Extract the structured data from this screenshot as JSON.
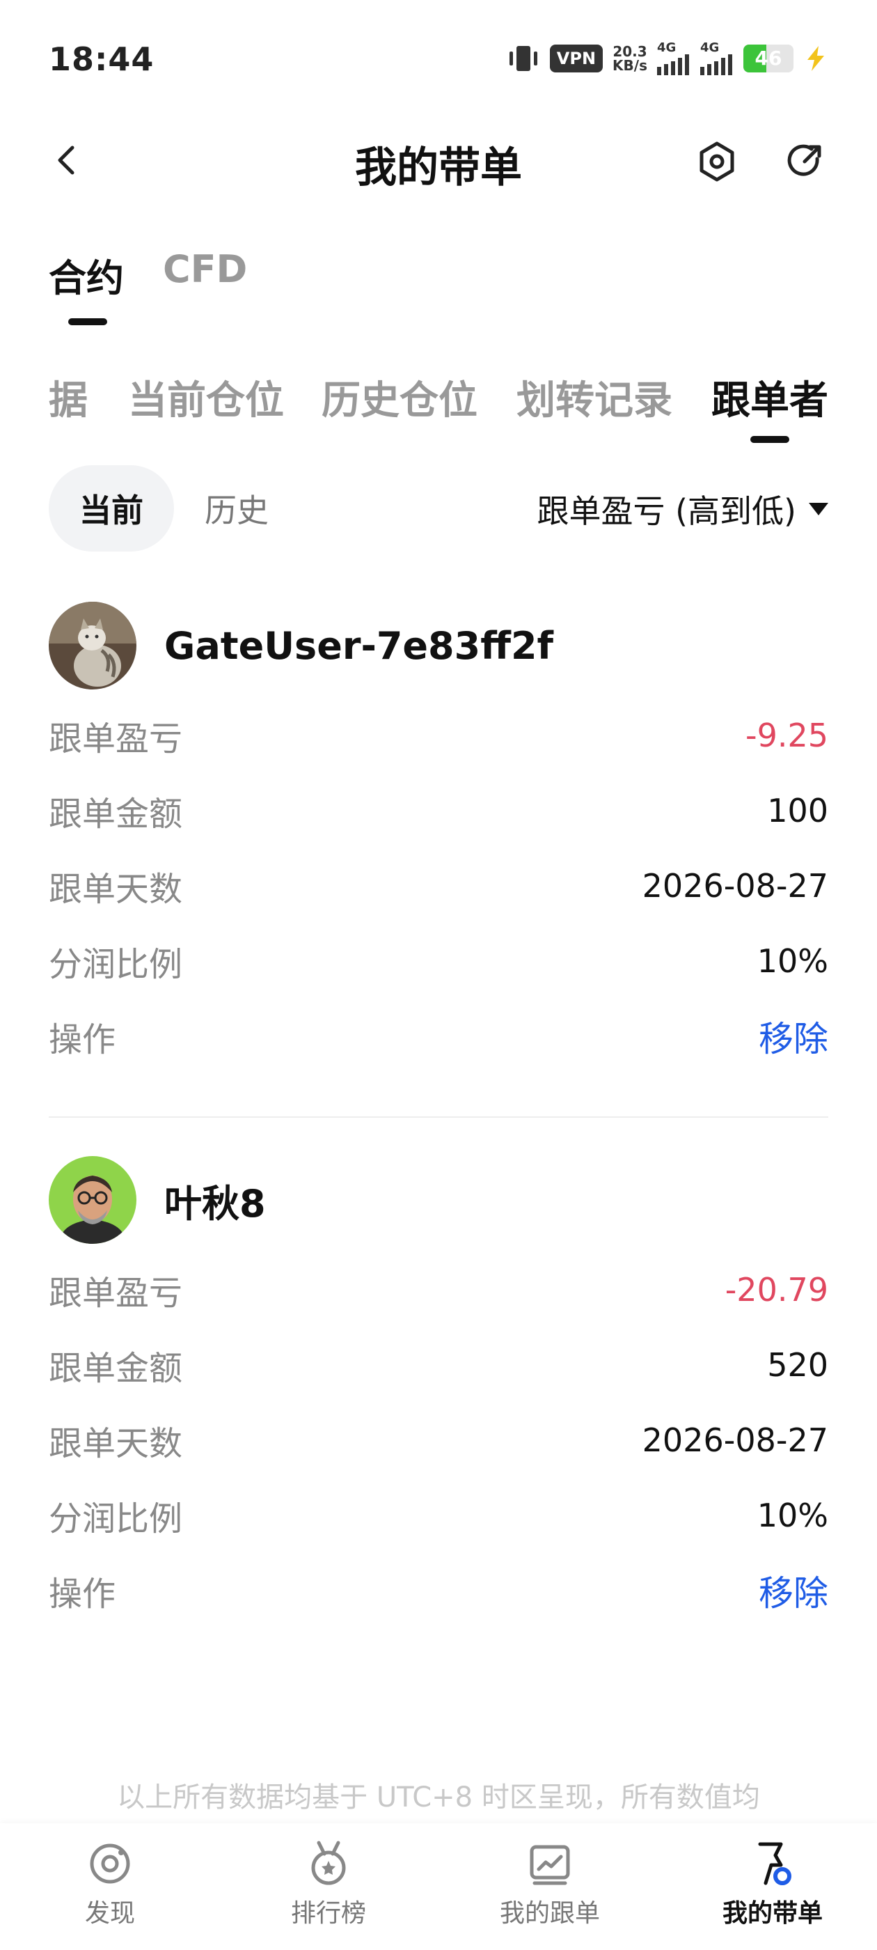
{
  "status_bar": {
    "time": "18:44",
    "vpn": "VPN",
    "net_speed_value": "20.3",
    "net_speed_unit": "KB/s",
    "signal1_label": "4G",
    "signal2_label": "4G",
    "battery": "46"
  },
  "header": {
    "title": "我的带单",
    "back_icon": "chevron-left-icon",
    "settings_icon": "hexagon-settings-icon",
    "share_icon": "refresh-share-icon"
  },
  "type_tabs": [
    {
      "label": "合约",
      "active": true
    },
    {
      "label": "CFD",
      "active": false
    }
  ],
  "sub_tabs": [
    {
      "label": "据",
      "active": false
    },
    {
      "label": "当前仓位",
      "active": false
    },
    {
      "label": "历史仓位",
      "active": false
    },
    {
      "label": "划转记录",
      "active": false
    },
    {
      "label": "跟单者",
      "active": true
    }
  ],
  "filter": {
    "current_label": "当前",
    "history_label": "历史",
    "sort_label": "跟单盈亏 (高到低)"
  },
  "followers": [
    {
      "name": "GateUser-7e83ff2f",
      "rows": [
        {
          "label": "跟单盈亏",
          "value": "-9.25"
        },
        {
          "label": "跟单金额",
          "value": "100"
        },
        {
          "label": "跟单天数",
          "value": "2026-08-27"
        },
        {
          "label": "分润比例",
          "value": "10%"
        },
        {
          "label": "操作",
          "value": "移除"
        }
      ]
    },
    {
      "name": "叶秋8",
      "rows": [
        {
          "label": "跟单盈亏",
          "value": "-20.79"
        },
        {
          "label": "跟单金额",
          "value": "520"
        },
        {
          "label": "跟单天数",
          "value": "2026-08-27"
        },
        {
          "label": "分润比例",
          "value": "10%"
        },
        {
          "label": "操作",
          "value": "移除"
        }
      ]
    }
  ],
  "footnote": "以上所有数据均基于 UTC+8 时区呈现，所有数值均",
  "bottom_nav": [
    {
      "label": "发现",
      "icon": "discover-icon",
      "active": false
    },
    {
      "label": "排行榜",
      "icon": "medal-icon",
      "active": false
    },
    {
      "label": "我的跟单",
      "icon": "chart-icon",
      "active": false
    },
    {
      "label": "我的带单",
      "icon": "lead-trader-icon",
      "active": true
    }
  ],
  "colors": {
    "negative": "#e0475f",
    "link": "#1f5ce6",
    "muted": "#888888"
  }
}
